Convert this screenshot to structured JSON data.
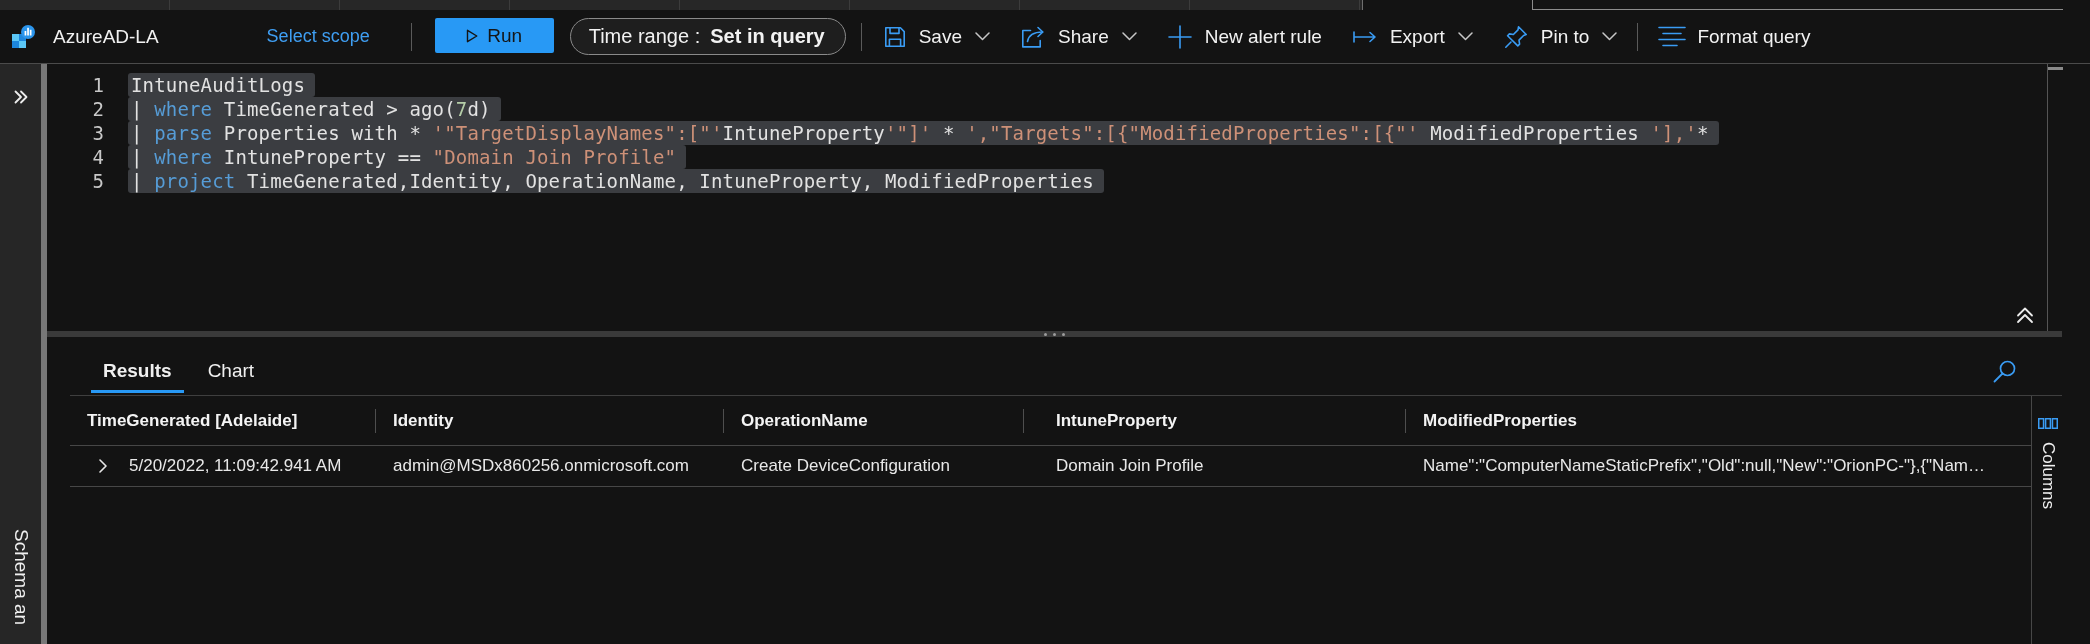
{
  "workspace": {
    "name": "AzureAD-LA",
    "scope_link": "Select scope"
  },
  "toolbar": {
    "run_button": "Run",
    "time_range": {
      "label": "Time range :",
      "value": "Set in query"
    },
    "actions": [
      {
        "label": "Save",
        "kind": "dropdown"
      },
      {
        "label": "Share",
        "kind": "dropdown"
      },
      {
        "label": "New alert rule",
        "kind": "button"
      },
      {
        "label": "Export",
        "kind": "dropdown"
      },
      {
        "label": "Pin to",
        "kind": "dropdown"
      },
      {
        "label": "Format query",
        "kind": "button"
      }
    ]
  },
  "sidebar": {
    "label": "Schema an"
  },
  "editor": {
    "lines": [
      {
        "number": "1",
        "selected": true,
        "tokens": [
          {
            "text": "IntuneAuditLogs",
            "kind": "plain"
          }
        ]
      },
      {
        "number": "2",
        "selected": true,
        "tokens": [
          {
            "text": "| ",
            "kind": "plain"
          },
          {
            "text": "where",
            "kind": "keyword"
          },
          {
            "text": " TimeGenerated > ago(",
            "kind": "plain"
          },
          {
            "text": "7",
            "kind": "number"
          },
          {
            "text": "d)",
            "kind": "plain"
          }
        ]
      },
      {
        "number": "3",
        "selected": true,
        "tokens": [
          {
            "text": "| ",
            "kind": "plain"
          },
          {
            "text": "parse",
            "kind": "keyword"
          },
          {
            "text": " Properties with * ",
            "kind": "plain"
          },
          {
            "text": "'\"TargetDisplayNames\":[\"'",
            "kind": "string"
          },
          {
            "text": "IntuneProperty",
            "kind": "plain"
          },
          {
            "text": "'\"]'",
            "kind": "string"
          },
          {
            "text": " * ",
            "kind": "plain"
          },
          {
            "text": "',\"Targets\":[{\"ModifiedProperties\":[{\"'",
            "kind": "string"
          },
          {
            "text": " ModifiedProperties ",
            "kind": "plain"
          },
          {
            "text": "'],'",
            "kind": "string"
          },
          {
            "text": "*",
            "kind": "plain"
          }
        ]
      },
      {
        "number": "4",
        "selected": true,
        "tokens": [
          {
            "text": "| ",
            "kind": "plain"
          },
          {
            "text": "where",
            "kind": "keyword"
          },
          {
            "text": " IntuneProperty == ",
            "kind": "plain"
          },
          {
            "text": "\"Domain Join Profile\"",
            "kind": "string"
          }
        ]
      },
      {
        "number": "5",
        "selected": true,
        "tokens": [
          {
            "text": "| ",
            "kind": "plain"
          },
          {
            "text": "project",
            "kind": "keyword"
          },
          {
            "text": " TimeGenerated,Identity, OperationName, IntuneProperty, ModifiedProperties",
            "kind": "plain"
          }
        ]
      }
    ]
  },
  "results": {
    "tabs": [
      {
        "label": "Results",
        "selected": true
      },
      {
        "label": "Chart",
        "selected": false
      }
    ],
    "table": {
      "columns": [
        "TimeGenerated [Adelaide]",
        "Identity",
        "OperationName",
        "IntuneProperty",
        "ModifiedProperties"
      ],
      "rows": [
        {
          "expanded": false,
          "cells": [
            "5/20/2022, 11:09:42.941 AM",
            "admin@MSDx860256.onmicrosoft.com",
            "Create DeviceConfiguration",
            "Domain Join Profile",
            "Name\":\"ComputerNameStaticPrefix\",\"Old\":null,\"New\":\"OrionPC-\"},{\"Nam…"
          ]
        }
      ]
    },
    "columns_panel": "Columns"
  }
}
